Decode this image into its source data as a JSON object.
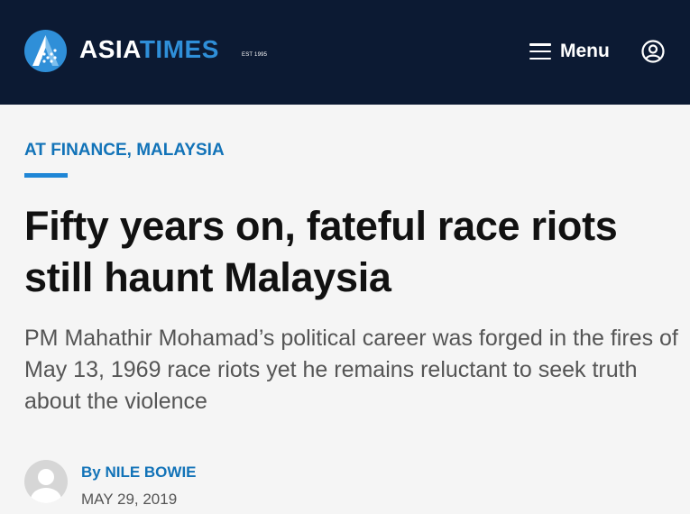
{
  "header": {
    "brand_asia": "ASIA",
    "brand_times": "TIMES",
    "brand_est": "EST 1995",
    "menu_label": "Menu",
    "colors": {
      "background": "#0c1a33",
      "accent": "#2f8fd8"
    },
    "icons": {
      "logo": "asia-times-logo-icon",
      "menu": "hamburger-menu-icon",
      "account": "user-account-icon"
    }
  },
  "article": {
    "category": "AT FINANCE, MALAYSIA",
    "headline": "Fifty years on, fateful race riots still haunt Malaysia",
    "subheadline": "PM Mahathir Mohamad’s political career was forged in the fires of May 13, 1969 race riots yet he remains reluctant to seek truth about the violence",
    "byline": "By NILE BOWIE",
    "date": "MAY 29, 2019",
    "colors": {
      "link": "#1273b8",
      "rule": "#1f86d6",
      "headline": "#111111",
      "subhead": "#555555"
    },
    "icons": {
      "avatar": "default-avatar-icon"
    }
  }
}
